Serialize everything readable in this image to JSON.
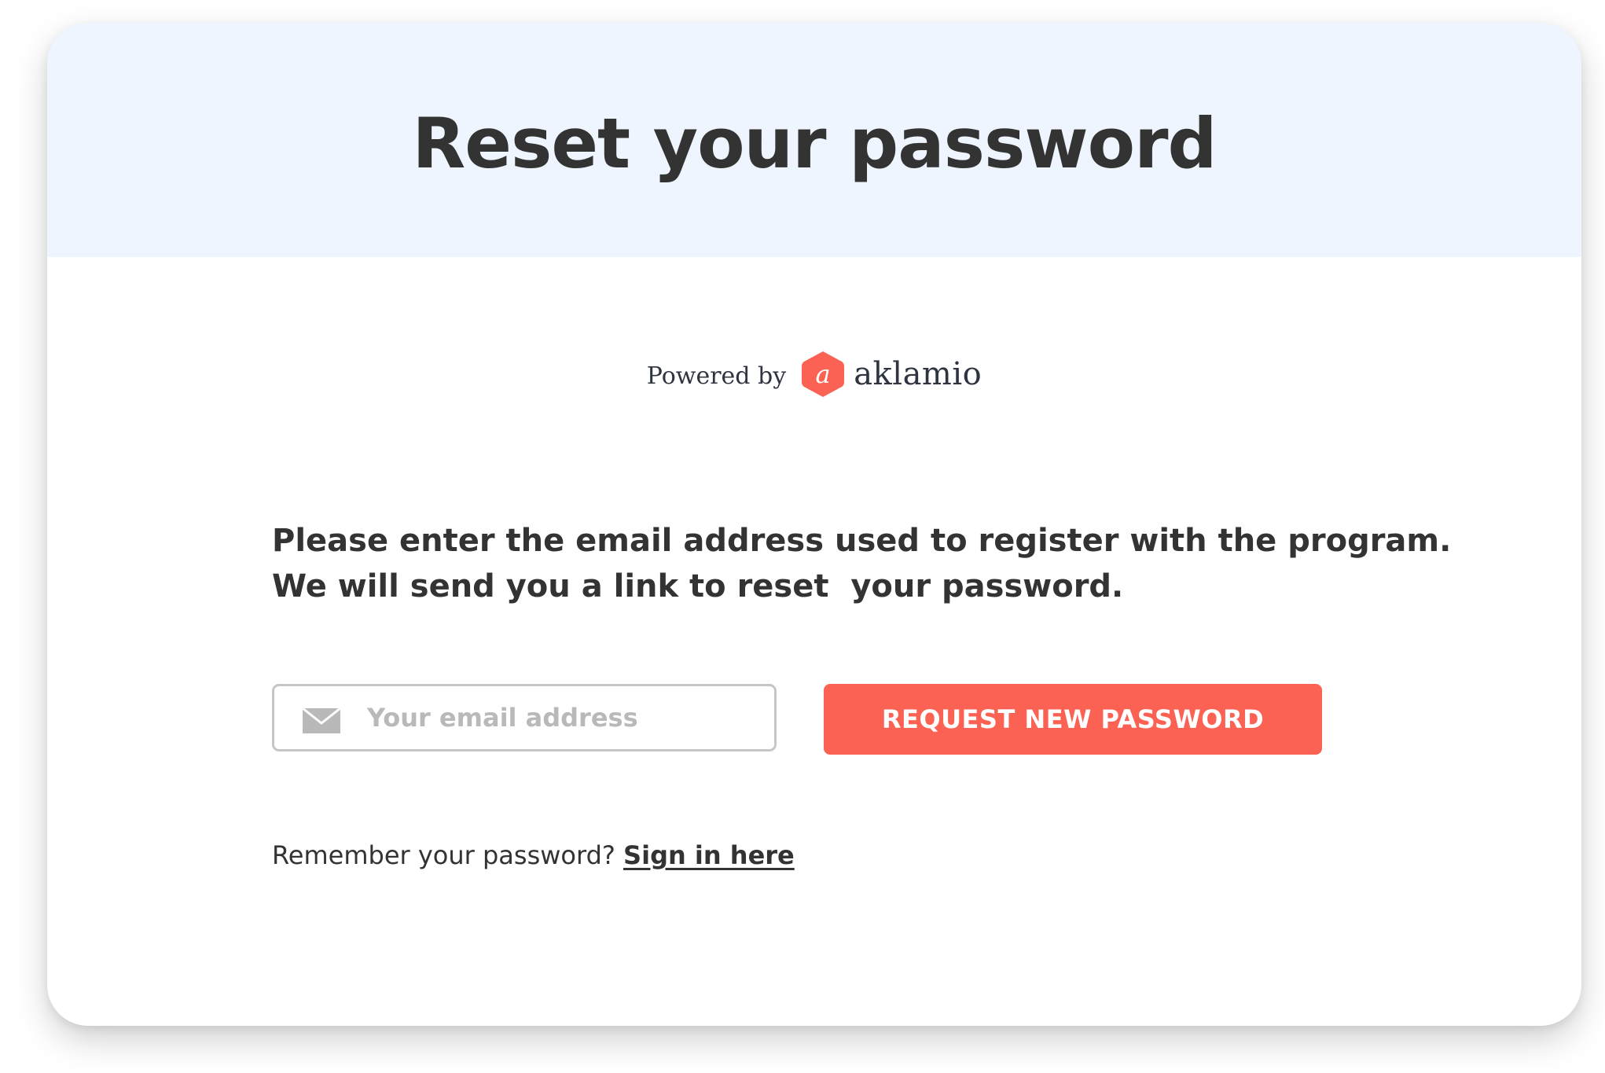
{
  "header": {
    "title": "Reset your password"
  },
  "branding": {
    "powered_by": "Powered by",
    "brand_name": "aklamio",
    "brand_icon": "aklamio-hexagon-logo-icon",
    "brand_color": "#fc6253"
  },
  "instructions": {
    "line1": "Please enter the email address used to register with the program.",
    "line2": "We will send you a link to reset  your password."
  },
  "form": {
    "email_icon": "envelope-icon",
    "email_placeholder": "Your email address",
    "email_value": "",
    "submit_label": "REQUEST NEW PASSWORD",
    "submit_color": "#fc6253"
  },
  "footer": {
    "prompt": "Remember your password?",
    "link_label": "Sign in here"
  },
  "colors": {
    "header_background": "#eef5fe",
    "text": "#333333"
  }
}
